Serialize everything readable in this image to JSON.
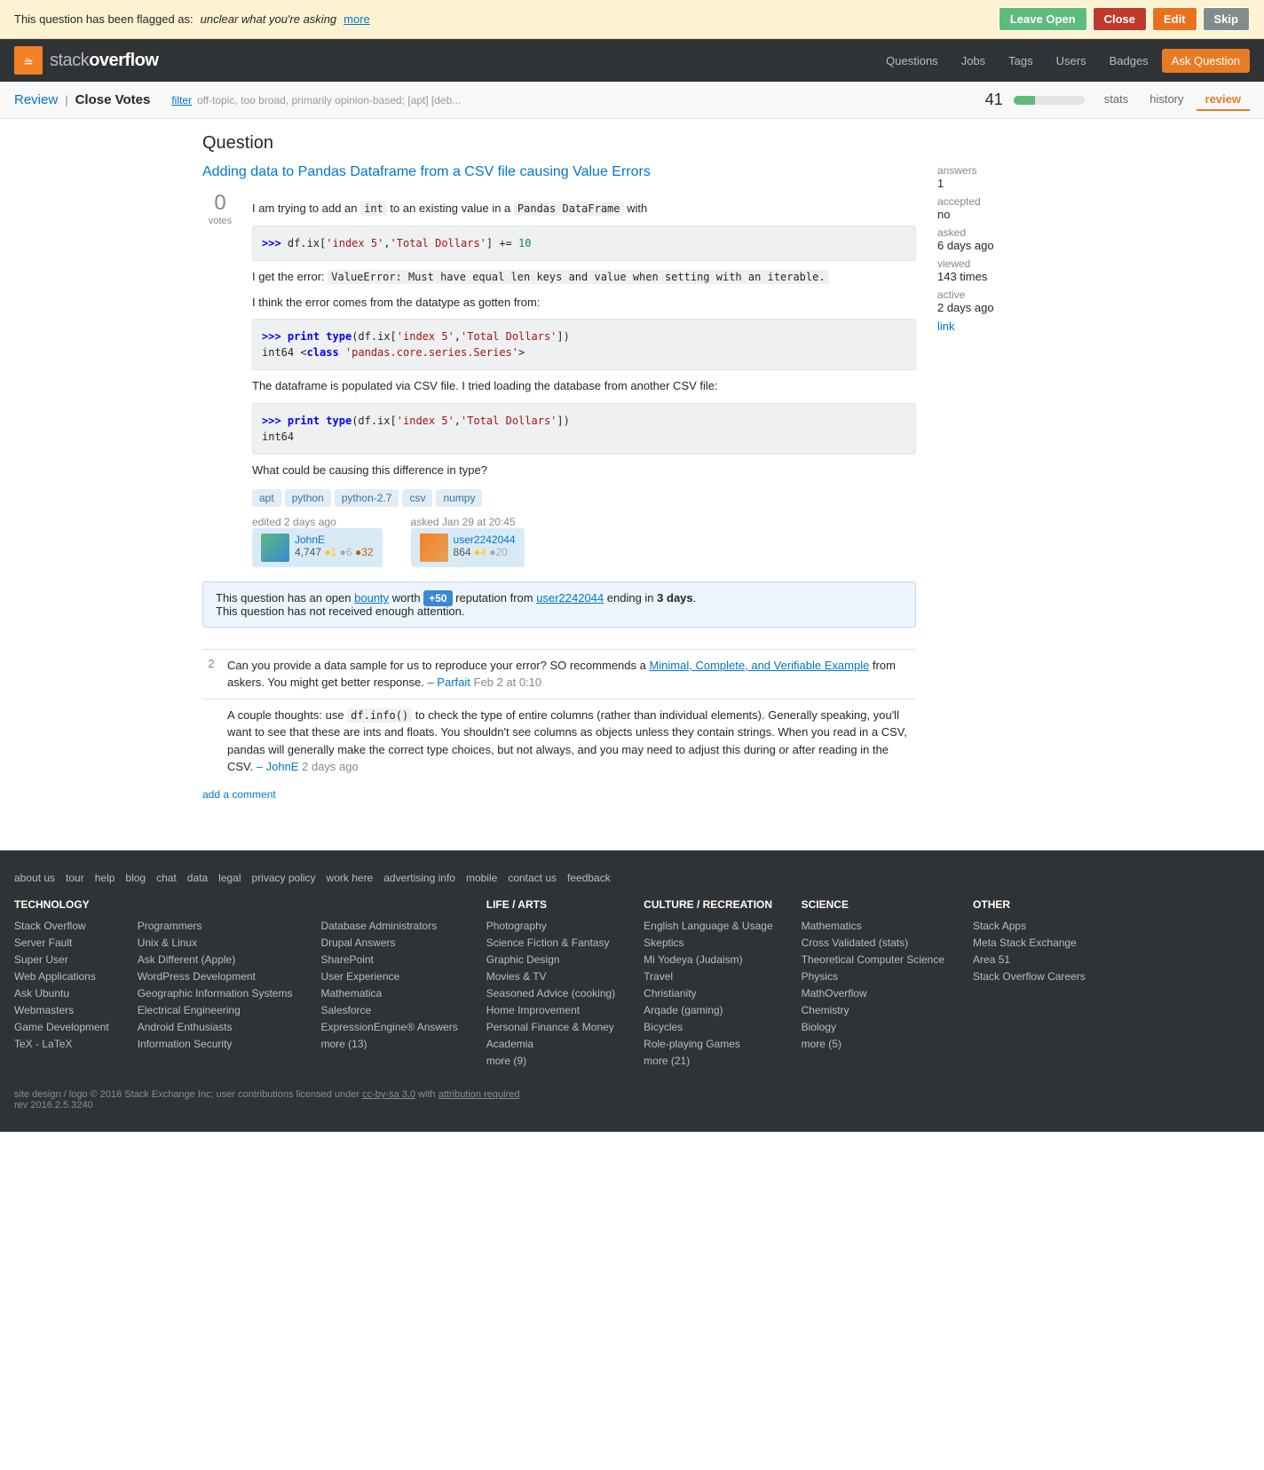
{
  "flagBar": {
    "message": "This question has been flagged as: ",
    "flagType": "unclear what you're asking",
    "moreLink": "more",
    "buttons": {
      "leaveOpen": "Leave Open",
      "close": "Close",
      "edit": "Edit",
      "skip": "Skip"
    }
  },
  "header": {
    "logoText": "stack",
    "logoTextBold": "overflow",
    "nav": [
      "Questions",
      "Jobs",
      "Tags",
      "Users",
      "Badges",
      "Ask Question"
    ]
  },
  "reviewHeader": {
    "breadcrumb": "Review",
    "separator": "|",
    "title": "Close Votes",
    "filterLabel": "filter",
    "filterTags": "off-topic, too broad, primarily opinion-based; [apt] [deb...",
    "statCount": "41",
    "tabs": [
      "stats",
      "history",
      "review"
    ],
    "activeTab": "review"
  },
  "question": {
    "sectionLabel": "Question",
    "voteCount": "0",
    "voteLabel": "votes",
    "title": "Adding data to Pandas Dataframe from a CSV file causing Value Errors",
    "body": {
      "intro": "I am trying to add an",
      "intCode": "int",
      "introRest": "to an existing value in a",
      "dfCode": "Pandas DataFrame",
      "introEnd": "with",
      "code1": ">>> df.ix['index 5','Total Dollars'] += 10",
      "errorIntro": "I get the error:",
      "errorCode": "ValueError: Must have equal len keys and value when setting with an iterable.",
      "thinkText": "I think the error comes from the datatype as gotten from:",
      "code2Lines": [
        ">>> print type(df.ix['index 5','Total Dollars'])",
        "int64 <class 'pandas.core.series.Series'>"
      ],
      "csvText": "The dataframe is populated via CSV file. I tried loading the database from another CSV file:",
      "code3Lines": [
        ">>> print type(df.ix['index 5','Total Dollars'])",
        "int64"
      ],
      "questionText": "What could be causing this difference in type?"
    },
    "tags": [
      "apt",
      "python",
      "python-2.7",
      "csv",
      "numpy"
    ],
    "editInfo": {
      "editedText": "edited 2 days ago",
      "username": "JohnE",
      "rep": "4,747",
      "gold": "1",
      "silver": "6",
      "bronze": "32"
    },
    "askedInfo": {
      "askedText": "asked Jan 29 at 20:45",
      "username": "user2242044",
      "rep": "864",
      "gold": "4",
      "silver": "20"
    },
    "meta": {
      "answersLabel": "answers",
      "answersValue": "1",
      "acceptedLabel": "accepted",
      "acceptedValue": "no",
      "askedLabel": "asked",
      "askedValue": "6 days ago",
      "viewedLabel": "viewed",
      "viewedValue": "143 times",
      "activeLabel": "active",
      "activeValue": "2 days ago",
      "linkText": "link"
    }
  },
  "bounty": {
    "text1": "This question has an open",
    "bountyLink": "bounty",
    "badge": "+50",
    "text2": "reputation from",
    "userLink": "user2242044",
    "text3": "ending in",
    "bold": "3 days",
    "text4": ".",
    "subtext": "This question has not received enough attention."
  },
  "comments": [
    {
      "vote": "2",
      "body": "Can you provide a data sample for us to reproduce your error? SO recommends a",
      "linkText": "Minimal, Complete, and Verifiable Example",
      "bodyEnd": "from askers. You might get better response.",
      "author": "– Parfait",
      "time": "Feb 2 at 0:10"
    },
    {
      "vote": "",
      "body": "A couple thoughts: use",
      "codeText": "df.info()",
      "bodyMid": "to check the type of entire columns (rather than individual elements). Generally speaking, you'll want to see that these are ints and floats. You shouldn't see columns as objects unless they contain strings. When you read in a CSV, pandas will generally make the correct type choices, but not always, and you may need to adjust this during or after reading in the CSV.",
      "author": "– JohnE",
      "time": "2 days ago"
    }
  ],
  "addComment": "add a comment",
  "footer": {
    "links": [
      "about us",
      "tour",
      "help",
      "blog",
      "chat",
      "data",
      "legal",
      "privacy policy",
      "work here",
      "advertising info",
      "mobile",
      "contact us",
      "feedback"
    ],
    "columns": {
      "technology": {
        "heading": "TECHNOLOGY",
        "items": [
          "Stack Overflow",
          "Server Fault",
          "Super User",
          "Web Applications",
          "Ask Ubuntu",
          "Webmasters",
          "Game Development",
          "TeX - LaTeX"
        ]
      },
      "technology2": {
        "heading": "",
        "items": [
          "Programmers",
          "Unix & Linux",
          "Ask Different (Apple)",
          "WordPress Development",
          "Geographic Information Systems",
          "Electrical Engineering",
          "Android Enthusiasts",
          "Information Security"
        ]
      },
      "technology3": {
        "heading": "",
        "items": [
          "Database Administrators",
          "Drupal Answers",
          "SharePoint",
          "User Experience",
          "Mathematica",
          "Salesforce",
          "ExpressionEngine® Answers",
          "more (13)"
        ]
      },
      "lifearts": {
        "heading": "LIFE / ARTS",
        "items": [
          "Photography",
          "Science Fiction & Fantasy",
          "Graphic Design",
          "Movies & TV",
          "Seasoned Advice (cooking)",
          "Home Improvement",
          "Personal Finance & Money",
          "Academia",
          "more (9)"
        ]
      },
      "culture": {
        "heading": "CULTURE / RECREATION",
        "items": [
          "English Language & Usage",
          "Skeptics",
          "Mi Yodeya (Judaism)",
          "Travel",
          "Christianity",
          "Arqade (gaming)",
          "Bicycles",
          "Role-playing Games",
          "more (21)"
        ]
      },
      "science": {
        "heading": "SCIENCE",
        "items": [
          "Mathematics",
          "Cross Validated (stats)",
          "Theoretical Computer Science",
          "Physics",
          "MathOverflow",
          "Chemistry",
          "Biology",
          "more (5)"
        ]
      },
      "other": {
        "heading": "OTHER",
        "items": [
          "Stack Apps",
          "Meta Stack Exchange",
          "Area 51",
          "Stack Overflow Careers"
        ]
      }
    },
    "copyright": "site design / logo © 2016 Stack Exchange Inc; user contributions licensed under",
    "ccLink": "cc-by-sa 3.0",
    "ccText": "with",
    "attrLink": "attribution required",
    "rev": "rev 2016.2.5.3240"
  }
}
